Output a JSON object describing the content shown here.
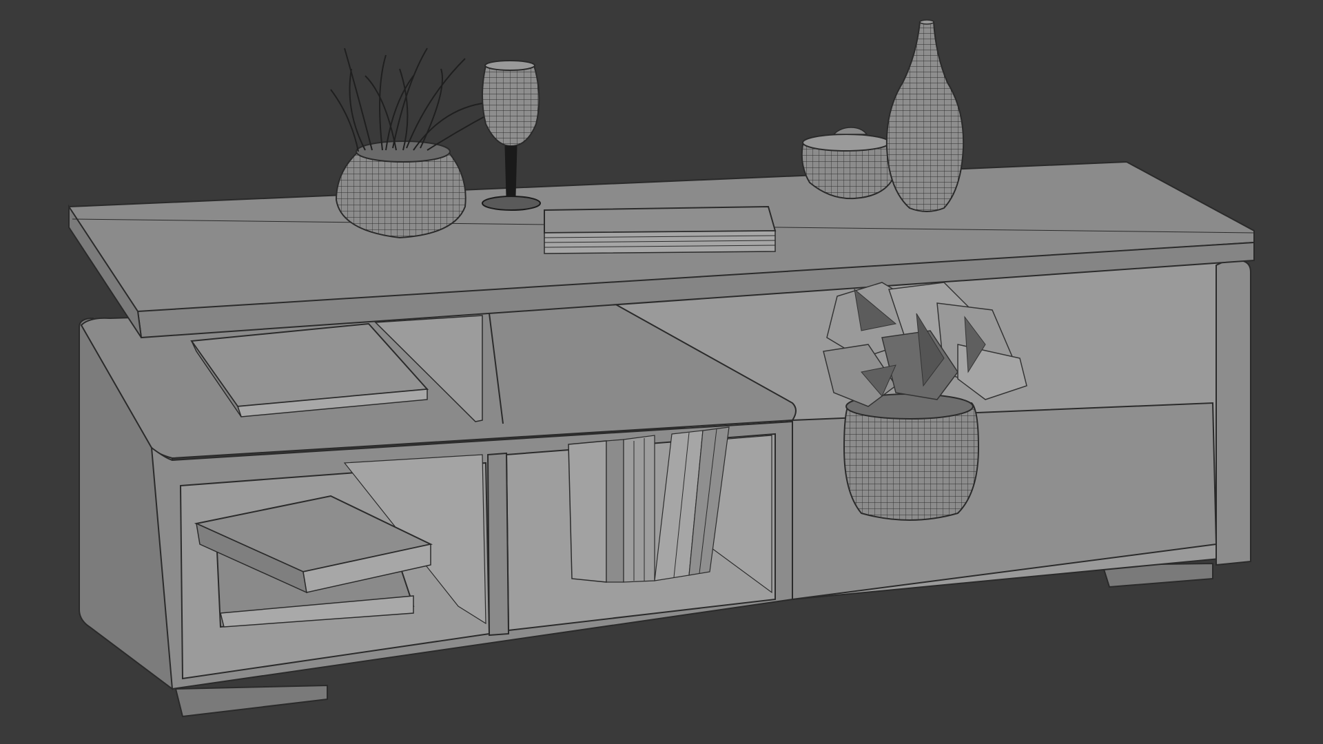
{
  "scene": {
    "subject": "coffee-table-wireframe-render",
    "background_color": "#3a3a3a",
    "surface_color": "#8a8a8a",
    "surface_light": "#9a9a9a",
    "surface_dark": "#6e6e6e",
    "edge_color": "#2a2a2a",
    "wire_color": "#222222"
  }
}
